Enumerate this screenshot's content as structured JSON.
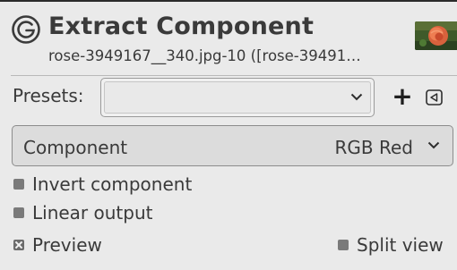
{
  "header": {
    "title": "Extract Component",
    "subtitle": "rose-3949167__340.jpg-10 ([rose-39491…",
    "icon": "gimp-filter-icon",
    "thumbnail": "rose-image-thumbnail"
  },
  "presets": {
    "label": "Presets:",
    "value": "",
    "add_icon_text": "+",
    "menu_icon": "menu-left-triangle-icon"
  },
  "component": {
    "label": "Component",
    "value": "RGB Red"
  },
  "options": {
    "invert_label": "Invert component",
    "invert_checked": false,
    "linear_label": "Linear output",
    "linear_checked": false,
    "preview_label": "Preview",
    "preview_checked": true,
    "split_label": "Split view",
    "split_checked": false
  },
  "colors": {
    "background": "#eaeaea",
    "text": "#3a3a3a",
    "border": "#8c8c8c"
  }
}
